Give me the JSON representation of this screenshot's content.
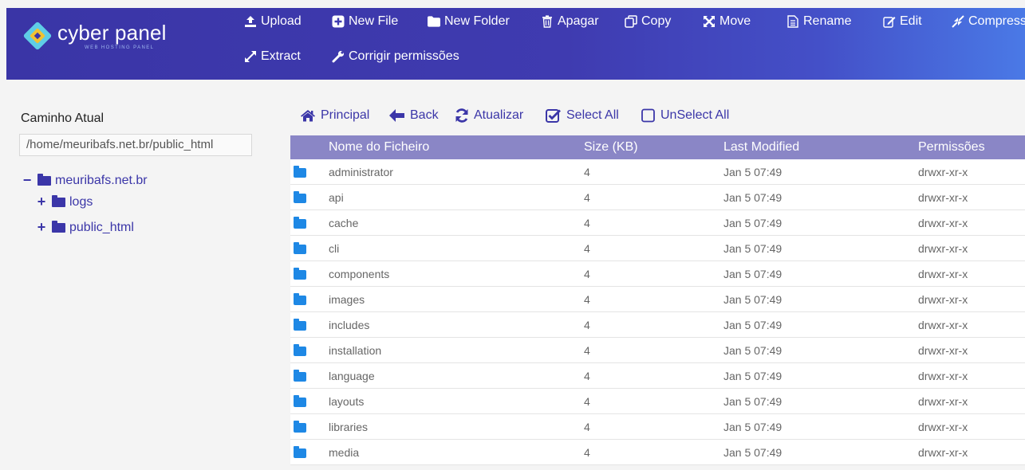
{
  "brand": {
    "name": "cyber panel",
    "tagline": "WEB HOSTING PANEL"
  },
  "toolbar": {
    "upload": "Upload",
    "new_file": "New File",
    "new_folder": "New Folder",
    "delete": "Apagar",
    "copy": "Copy",
    "move": "Move",
    "rename": "Rename",
    "edit": "Edit",
    "compress": "Compress",
    "extract": "Extract",
    "fix_permissions": "Corrigir permissões"
  },
  "sidebar": {
    "current_path_label": "Caminho Atual",
    "current_path": "/home/meuribafs.net.br/public_html",
    "tree": {
      "root": "meuribafs.net.br",
      "children": [
        "logs",
        "public_html"
      ]
    }
  },
  "nav": {
    "home": "Principal",
    "back": "Back",
    "refresh": "Atualizar",
    "select_all": "Select All",
    "unselect_all": "UnSelect All"
  },
  "table": {
    "headers": {
      "name": "Nome do Ficheiro",
      "size": "Size (KB)",
      "modified": "Last Modified",
      "permissions": "Permissões"
    },
    "rows": [
      {
        "name": "administrator",
        "size": "4",
        "modified": "Jan 5 07:49",
        "permissions": "drwxr-xr-x"
      },
      {
        "name": "api",
        "size": "4",
        "modified": "Jan 5 07:49",
        "permissions": "drwxr-xr-x"
      },
      {
        "name": "cache",
        "size": "4",
        "modified": "Jan 5 07:49",
        "permissions": "drwxr-xr-x"
      },
      {
        "name": "cli",
        "size": "4",
        "modified": "Jan 5 07:49",
        "permissions": "drwxr-xr-x"
      },
      {
        "name": "components",
        "size": "4",
        "modified": "Jan 5 07:49",
        "permissions": "drwxr-xr-x"
      },
      {
        "name": "images",
        "size": "4",
        "modified": "Jan 5 07:49",
        "permissions": "drwxr-xr-x"
      },
      {
        "name": "includes",
        "size": "4",
        "modified": "Jan 5 07:49",
        "permissions": "drwxr-xr-x"
      },
      {
        "name": "installation",
        "size": "4",
        "modified": "Jan 5 07:49",
        "permissions": "drwxr-xr-x"
      },
      {
        "name": "language",
        "size": "4",
        "modified": "Jan 5 07:49",
        "permissions": "drwxr-xr-x"
      },
      {
        "name": "layouts",
        "size": "4",
        "modified": "Jan 5 07:49",
        "permissions": "drwxr-xr-x"
      },
      {
        "name": "libraries",
        "size": "4",
        "modified": "Jan 5 07:49",
        "permissions": "drwxr-xr-x"
      },
      {
        "name": "media",
        "size": "4",
        "modified": "Jan 5 07:49",
        "permissions": "drwxr-xr-x"
      }
    ]
  },
  "colors": {
    "header": "#3f3bb0",
    "accent": "#3b36a8",
    "table_header": "#8a86c6",
    "folder_icon": "#1e88e5"
  }
}
